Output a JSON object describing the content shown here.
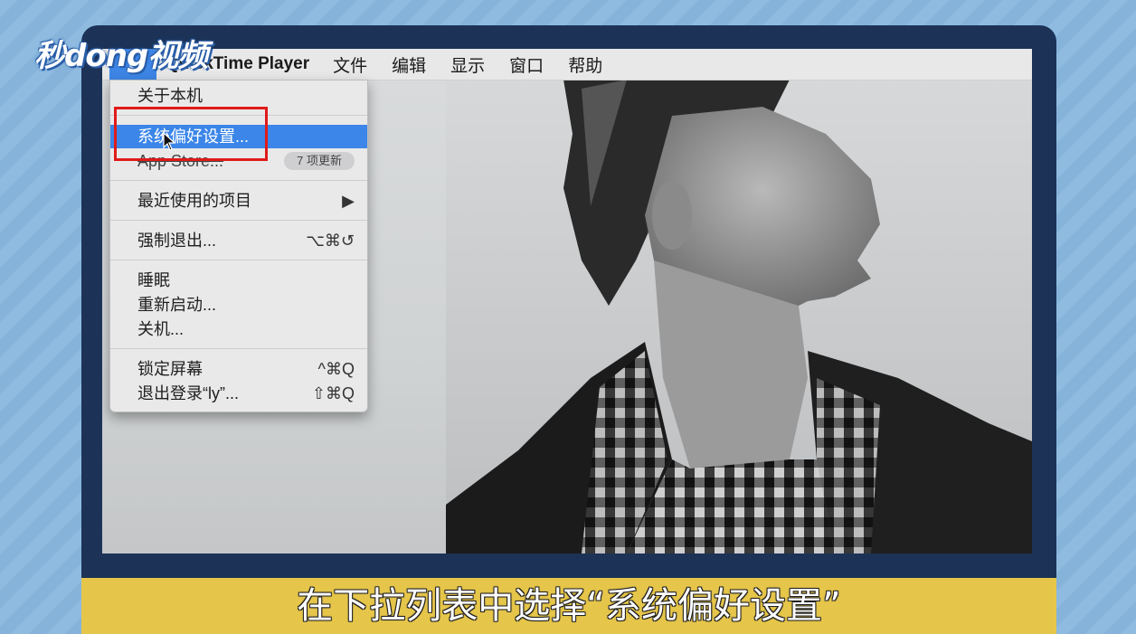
{
  "watermark": "秒dong视频",
  "menubar": {
    "app_name": "QuickTime Player",
    "items": [
      "文件",
      "编辑",
      "显示",
      "窗口",
      "帮助"
    ]
  },
  "apple_menu": {
    "about": "关于本机",
    "system_prefs": "系统偏好设置...",
    "app_store": "App Store...",
    "app_store_badge": "7 项更新",
    "recent_items": "最近使用的项目",
    "recent_items_arrow": "▶",
    "force_quit": "强制退出...",
    "force_quit_shortcut": "⌥⌘↺",
    "sleep": "睡眠",
    "restart": "重新启动...",
    "shutdown": "关机...",
    "lock_screen": "锁定屏幕",
    "lock_screen_shortcut": "^⌘Q",
    "logout": "退出登录“ly”...",
    "logout_shortcut": "⇧⌘Q"
  },
  "caption": "在下拉列表中选择“系统偏好设置”",
  "colors": {
    "highlight": "#3b86e8",
    "annotation_box": "#e01a1a",
    "caption_bar": "#e6c64a",
    "frame": "#1c3357"
  }
}
